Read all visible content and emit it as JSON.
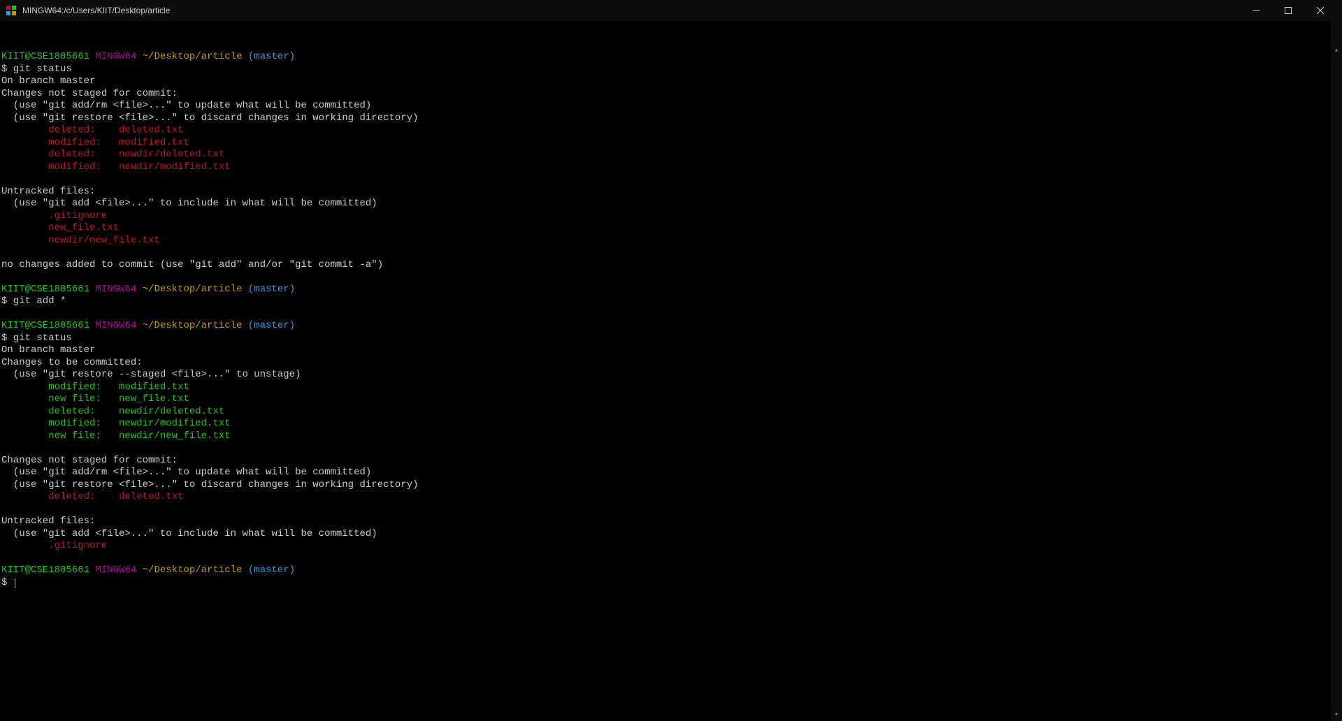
{
  "window": {
    "title": "MINGW64:/c/Users/KIIT/Desktop/article"
  },
  "prompt": {
    "user_host": "KIIT@CSE1805661",
    "env": "MINGW64",
    "path": "~/Desktop/article",
    "branch": "(master)",
    "symbol": "$"
  },
  "commands": {
    "git_status": "git status",
    "git_add": "git add *"
  },
  "status1": {
    "on_branch": "On branch master",
    "not_staged_hdr": "Changes not staged for commit:",
    "hint_add": "  (use \"git add/rm <file>...\" to update what will be committed)",
    "hint_restore": "  (use \"git restore <file>...\" to discard changes in working directory)",
    "entries": [
      {
        "status": "deleted:",
        "file": "deleted.txt"
      },
      {
        "status": "modified:",
        "file": "modified.txt"
      },
      {
        "status": "deleted:",
        "file": "newdir/deleted.txt"
      },
      {
        "status": "modified:",
        "file": "newdir/modified.txt"
      }
    ],
    "untracked_hdr": "Untracked files:",
    "untracked_hint": "  (use \"git add <file>...\" to include in what will be committed)",
    "untracked": [
      ".gitignore",
      "new_file.txt",
      "newdir/new_file.txt"
    ],
    "no_changes": "no changes added to commit (use \"git add\" and/or \"git commit -a\")"
  },
  "status2": {
    "on_branch": "On branch master",
    "to_commit_hdr": "Changes to be committed:",
    "to_commit_hint": "  (use \"git restore --staged <file>...\" to unstage)",
    "staged": [
      {
        "status": "modified:",
        "file": "modified.txt"
      },
      {
        "status": "new file:",
        "file": "new_file.txt"
      },
      {
        "status": "deleted:",
        "file": "newdir/deleted.txt"
      },
      {
        "status": "modified:",
        "file": "newdir/modified.txt"
      },
      {
        "status": "new file:",
        "file": "newdir/new_file.txt"
      }
    ],
    "not_staged_hdr": "Changes not staged for commit:",
    "hint_add": "  (use \"git add/rm <file>...\" to update what will be committed)",
    "hint_restore": "  (use \"git restore <file>...\" to discard changes in working directory)",
    "unstaged": [
      {
        "status": "deleted:",
        "file": "deleted.txt"
      }
    ],
    "untracked_hdr": "Untracked files:",
    "untracked_hint": "  (use \"git add <file>...\" to include in what will be committed)",
    "untracked": [
      ".gitignore"
    ]
  },
  "indent": "        ",
  "col_pad": "   "
}
